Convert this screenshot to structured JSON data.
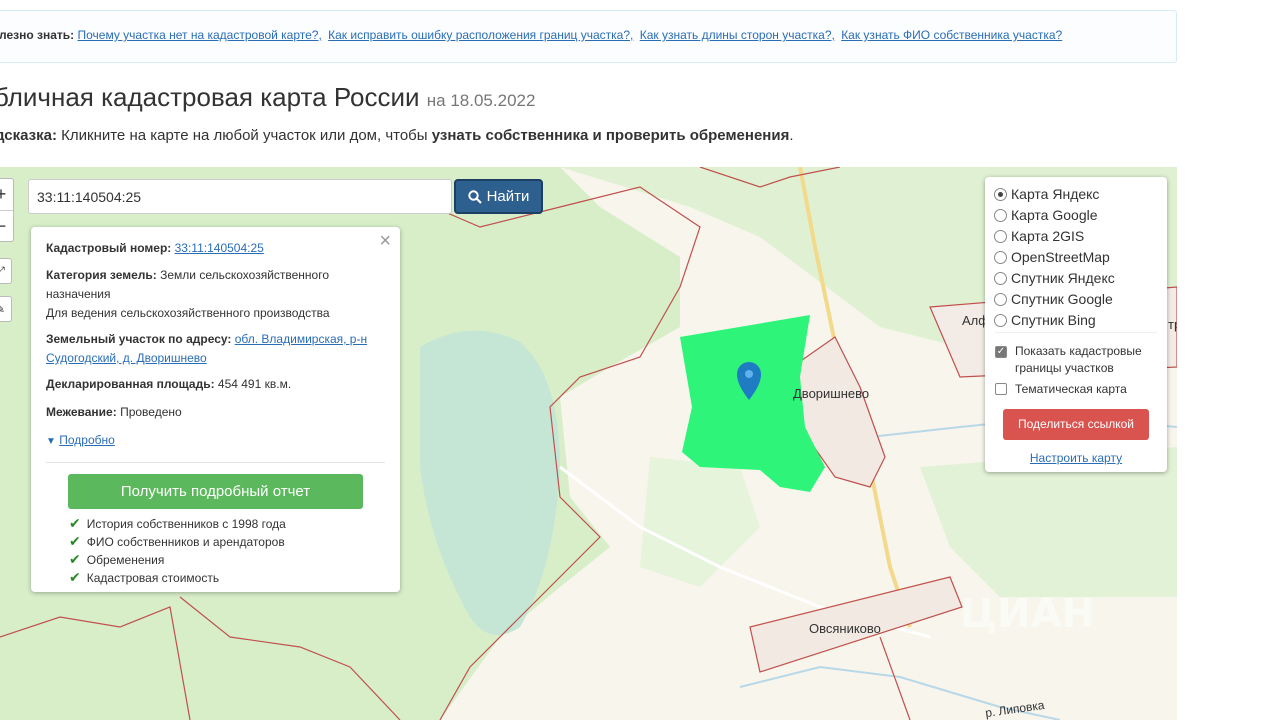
{
  "info_bar": {
    "prefix": "лезно знать:",
    "links": [
      "Почему участка нет на кадастровой карте?,",
      "Как исправить ошибку расположения границ участка?,",
      "Как узнать длины сторон участка?,",
      "Как узнать ФИО собственника участка?"
    ]
  },
  "heading": {
    "title": "бличная кадастровая карта России",
    "date": "на 18.05.2022"
  },
  "hint": {
    "label": "одсказка:",
    "text": "Кликните на карте на любой участок или дом, чтобы",
    "bold": "узнать собственника и проверить обременения",
    "end": "."
  },
  "search": {
    "value": "33:11:140504:25",
    "button": "Найти"
  },
  "popup": {
    "cad_label": "Кадастровый номер:",
    "cad_value": "33:11:140504:25",
    "cat_label": "Категория земель:",
    "cat_value": "Земли сельскохозяйственного назначения",
    "use_value": "Для ведения сельскохозяйственного производства",
    "addr_label": "Земельный участок по адресу:",
    "addr_value": "обл. Владимирская, р-н Судогодский, д. Дворишнево",
    "area_label": "Декларированная площадь:",
    "area_value": "454 491 кв.м.",
    "survey_label": "Межевание:",
    "survey_value": "Проведено",
    "more": "Подробно",
    "report_button": "Получить подробный отчет",
    "features": [
      "История собственников с 1998 года",
      "ФИО собственников и арендаторов",
      "Обременения",
      "Кадастровая стоимость"
    ]
  },
  "layers": {
    "options": [
      "Карта Яндекс",
      "Карта Google",
      "Карта 2GIS",
      "OpenStreetMap",
      "Спутник Яндекс",
      "Спутник Google",
      "Спутник Bing"
    ],
    "selected": "Карта Яндекс",
    "show_borders": "Показать кадастровые границы участков",
    "show_borders_checked": true,
    "thematic": "Тематическая карта",
    "thematic_checked": false,
    "share_button": "Поделиться ссылкой",
    "configure": "Настроить карту"
  },
  "map_labels": {
    "village1": "Дворишнево",
    "village2": "Овсяниково",
    "edge_left": "Алф",
    "edge_right": "тр",
    "river": "р. Липовка",
    "watermark": "ЦИАН"
  },
  "colors": {
    "parcel": "#2ef57a",
    "forest": "#d7eec9",
    "lake": "#c5e6d5",
    "boundary": "#c0504d",
    "road": "#f3d98a"
  }
}
